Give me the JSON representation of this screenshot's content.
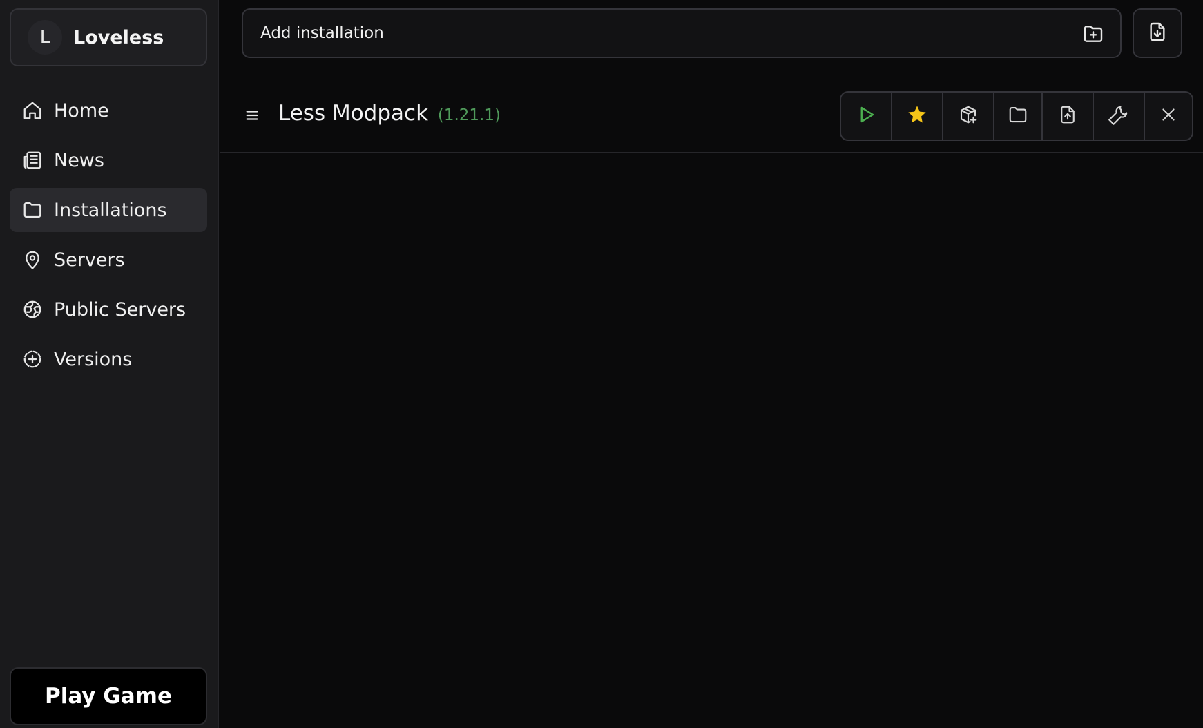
{
  "profile": {
    "initial": "L",
    "name": "Loveless"
  },
  "nav": {
    "items": [
      {
        "label": "Home",
        "icon": "home-icon"
      },
      {
        "label": "News",
        "icon": "news-icon"
      },
      {
        "label": "Installations",
        "icon": "folder-icon",
        "active": true
      },
      {
        "label": "Servers",
        "icon": "map-pin-icon"
      },
      {
        "label": "Public Servers",
        "icon": "globe-icon"
      },
      {
        "label": "Versions",
        "icon": "add-circle-icon"
      }
    ]
  },
  "play_game": {
    "label": "Play Game"
  },
  "add_installation": {
    "label": "Add installation",
    "icon": "folder-plus-icon"
  },
  "import_button": {
    "icon": "file-download-icon"
  },
  "installation": {
    "name": "Less Modpack",
    "version": "(1.21.1)",
    "actions": [
      "play-icon",
      "star-icon",
      "package-plus-icon",
      "folder-icon",
      "file-upload-icon",
      "wrench-icon",
      "close-icon"
    ]
  },
  "colors": {
    "accent_green": "#4caf50",
    "star": "#f5c518",
    "version_text": "#4f9a5a"
  }
}
